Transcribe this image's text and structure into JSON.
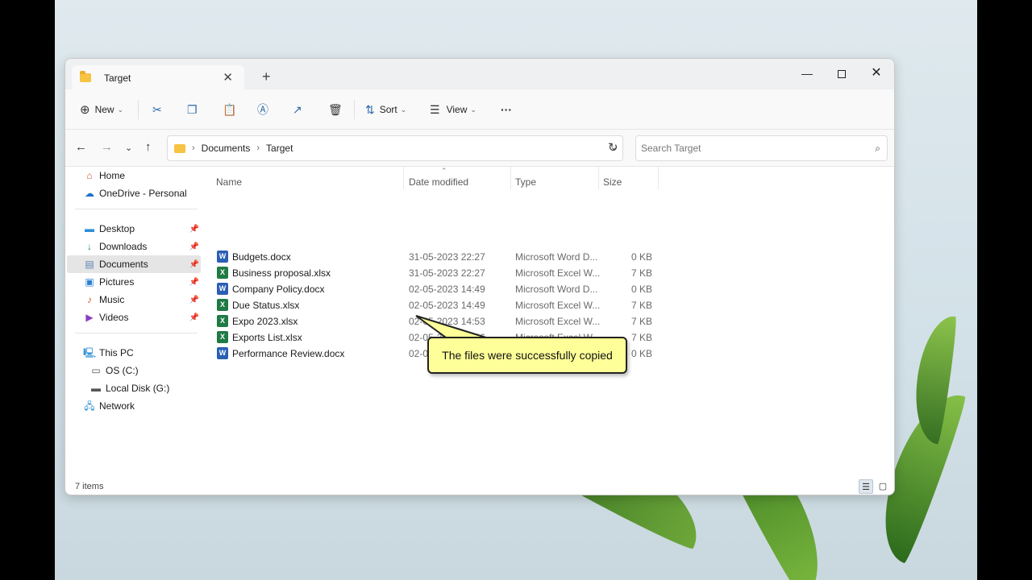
{
  "window": {
    "tab_title": "Target",
    "new_tab": "+",
    "minimize": "—",
    "close": "✕"
  },
  "toolbar": {
    "new_label": "New",
    "sort_label": "Sort",
    "view_label": "View",
    "more_label": "···"
  },
  "address": {
    "crumbs": [
      "Documents",
      "Target"
    ],
    "search_placeholder": "Search Target"
  },
  "sidebar": {
    "items": [
      {
        "label": "Home",
        "icon": "home-icon"
      },
      {
        "label": "OneDrive - Personal",
        "icon": "cloud-icon"
      },
      {
        "label": "Desktop",
        "icon": "desktop-icon"
      },
      {
        "label": "Downloads",
        "icon": "download-icon"
      },
      {
        "label": "Documents",
        "icon": "document-icon"
      },
      {
        "label": "Pictures",
        "icon": "picture-icon"
      },
      {
        "label": "Music",
        "icon": "music-icon"
      },
      {
        "label": "Videos",
        "icon": "video-icon"
      },
      {
        "label": "This PC",
        "icon": "computer-icon"
      },
      {
        "label": "OS (C:)",
        "icon": "drive-icon"
      },
      {
        "label": "Local Disk (G:)",
        "icon": "drive-icon"
      },
      {
        "label": "Network",
        "icon": "network-icon"
      }
    ],
    "selected": "Documents"
  },
  "columns": {
    "name": "Name",
    "date": "Date modified",
    "type": "Type",
    "size": "Size"
  },
  "files": [
    {
      "name": "Budgets.docx",
      "date": "31-05-2023 22:27",
      "type": "Microsoft Word D...",
      "size": "0 KB",
      "kind": "word"
    },
    {
      "name": "Business proposal.xlsx",
      "date": "31-05-2023 22:27",
      "type": "Microsoft Excel W...",
      "size": "7 KB",
      "kind": "excel"
    },
    {
      "name": "Company Policy.docx",
      "date": "02-05-2023 14:49",
      "type": "Microsoft Word D...",
      "size": "0 KB",
      "kind": "word"
    },
    {
      "name": "Due Status.xlsx",
      "date": "02-05-2023 14:49",
      "type": "Microsoft Excel W...",
      "size": "7 KB",
      "kind": "excel"
    },
    {
      "name": "Expo 2023.xlsx",
      "date": "02-05-2023 14:53",
      "type": "Microsoft Excel W...",
      "size": "7 KB",
      "kind": "excel"
    },
    {
      "name": "Exports List.xlsx",
      "date": "02-05-2023 14:46",
      "type": "Microsoft Excel W...",
      "size": "7 KB",
      "kind": "excel"
    },
    {
      "name": "Performance Review.docx",
      "date": "02-05-2023 14:46",
      "type": "Microsoft Word D...",
      "size": "0 KB",
      "kind": "word"
    }
  ],
  "status": {
    "count": "7 items"
  },
  "callout": {
    "text": "The files were successfully copied"
  },
  "colors": {
    "callout_bg": "#ffff99",
    "word": "#2b5fb4",
    "excel": "#1f7a44",
    "selection": "#e5e5e5"
  }
}
